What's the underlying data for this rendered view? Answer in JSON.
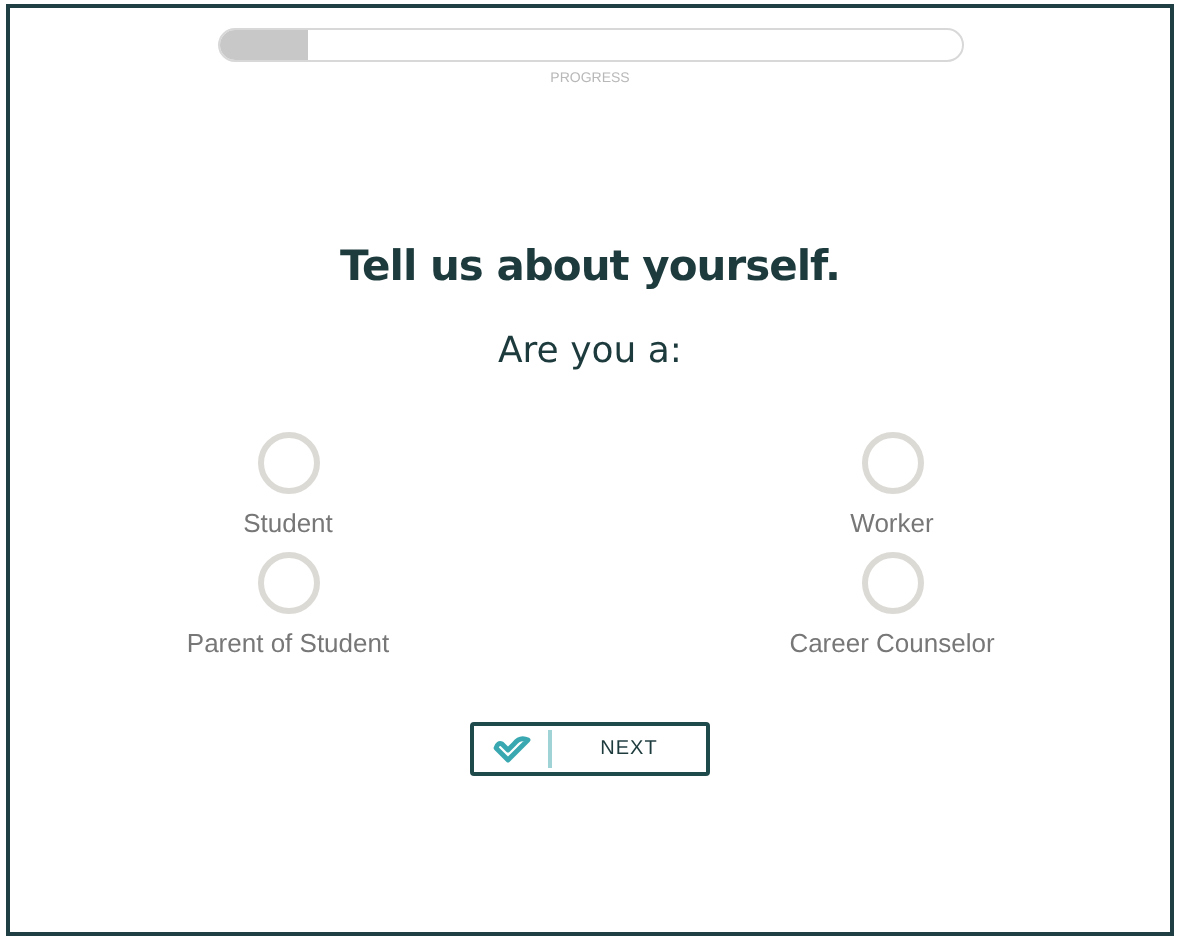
{
  "progress": {
    "level": 0.12,
    "label": "PROGRESS"
  },
  "title": "Tell us about yourself.",
  "question": "Are you a:",
  "options": [
    {
      "label": "Student",
      "selected": false
    },
    {
      "label": "Worker",
      "selected": false
    },
    {
      "label": "Parent of Student",
      "selected": false
    },
    {
      "label": "Career Counselor",
      "selected": false
    }
  ],
  "next_button": {
    "label": "NEXT"
  }
}
